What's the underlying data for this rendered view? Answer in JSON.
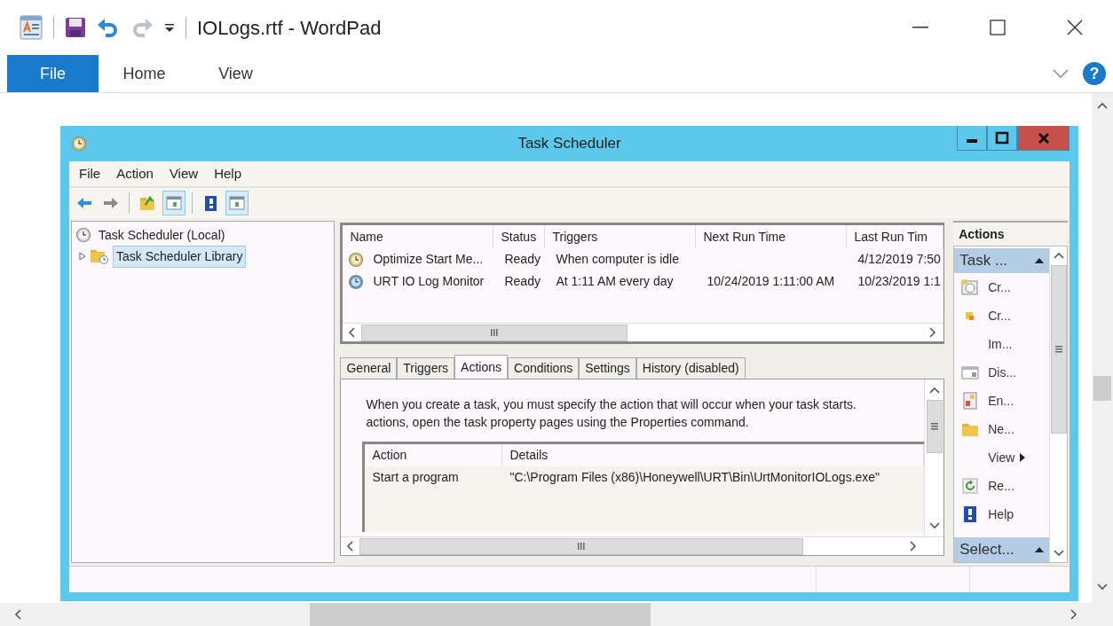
{
  "wordpad": {
    "title": "IOLogs.rtf - WordPad",
    "help": "?",
    "ribbon_tabs": [
      {
        "label": "File",
        "selected": true
      },
      {
        "label": "Home",
        "selected": false
      },
      {
        "label": "View",
        "selected": false
      }
    ]
  },
  "task_scheduler": {
    "title": "Task Scheduler",
    "menu": [
      "File",
      "Action",
      "View",
      "Help"
    ],
    "toolbar": [
      {
        "kind": "back",
        "pressed": false
      },
      {
        "kind": "forward",
        "pressed": false
      },
      {
        "kind": "up",
        "pressed": false
      },
      {
        "kind": "console",
        "pressed": true
      },
      {
        "kind": "help",
        "pressed": false
      },
      {
        "kind": "pane",
        "pressed": true
      }
    ],
    "tree": [
      {
        "label": "Task Scheduler (Local)",
        "selected": false,
        "children": [
          {
            "label": "Task Scheduler Library",
            "selected": true,
            "expanded": false
          }
        ]
      }
    ],
    "task_list": {
      "columns": [
        "Name",
        "Status",
        "Triggers",
        "Next Run Time",
        "Last Run Tim"
      ],
      "rows": [
        {
          "color": "#e6c35c",
          "cells": [
            "Optimize Start Me...",
            "Ready",
            "When computer is idle",
            "",
            "4/12/2019 7:50"
          ]
        },
        {
          "color": "#5b9bd5",
          "cells": [
            "URT IO Log Monitor",
            "Ready",
            "At 1:11 AM every day",
            "10/24/2019 1:11:00 AM",
            "10/23/2019 1:1"
          ]
        }
      ]
    },
    "detail_tabs": [
      {
        "label": "General",
        "selected": false
      },
      {
        "label": "Triggers",
        "selected": false
      },
      {
        "label": "Actions",
        "selected": true
      },
      {
        "label": "Conditions",
        "selected": false
      },
      {
        "label": "Settings",
        "selected": false
      },
      {
        "label": "History (disabled)",
        "selected": false
      }
    ],
    "description": [
      "When you create a task, you must specify the action that will occur when your task starts.",
      "actions, open the task property pages using the Properties command."
    ],
    "actions_table": {
      "columns": [
        "Action",
        "Details"
      ],
      "rows": [
        [
          "Start a program",
          "\"C:\\Program Files (x86)\\Honeywell\\URT\\Bin\\UrtMonitorIOLogs.exe\""
        ]
      ]
    },
    "actions_pane": {
      "title": "Actions",
      "sections": [
        {
          "label": "Task ...",
          "expanded": true,
          "items": [
            {
              "label": "Cr...",
              "kind": "task",
              "submenu": false
            },
            {
              "label": "Cr...",
              "kind": "basic",
              "submenu": false
            },
            {
              "label": "Im...",
              "kind": "none",
              "submenu": false
            },
            {
              "label": "Dis...",
              "kind": "display",
              "submenu": false
            },
            {
              "label": "En...",
              "kind": "enable",
              "submenu": false
            },
            {
              "label": "Ne...",
              "kind": "folder",
              "submenu": false
            },
            {
              "label": "View",
              "kind": "none",
              "submenu": true
            },
            {
              "label": "Re...",
              "kind": "refresh",
              "submenu": false
            },
            {
              "label": "Help",
              "kind": "help",
              "submenu": false
            }
          ]
        },
        {
          "label": "Select...",
          "expanded": true
        }
      ]
    }
  }
}
